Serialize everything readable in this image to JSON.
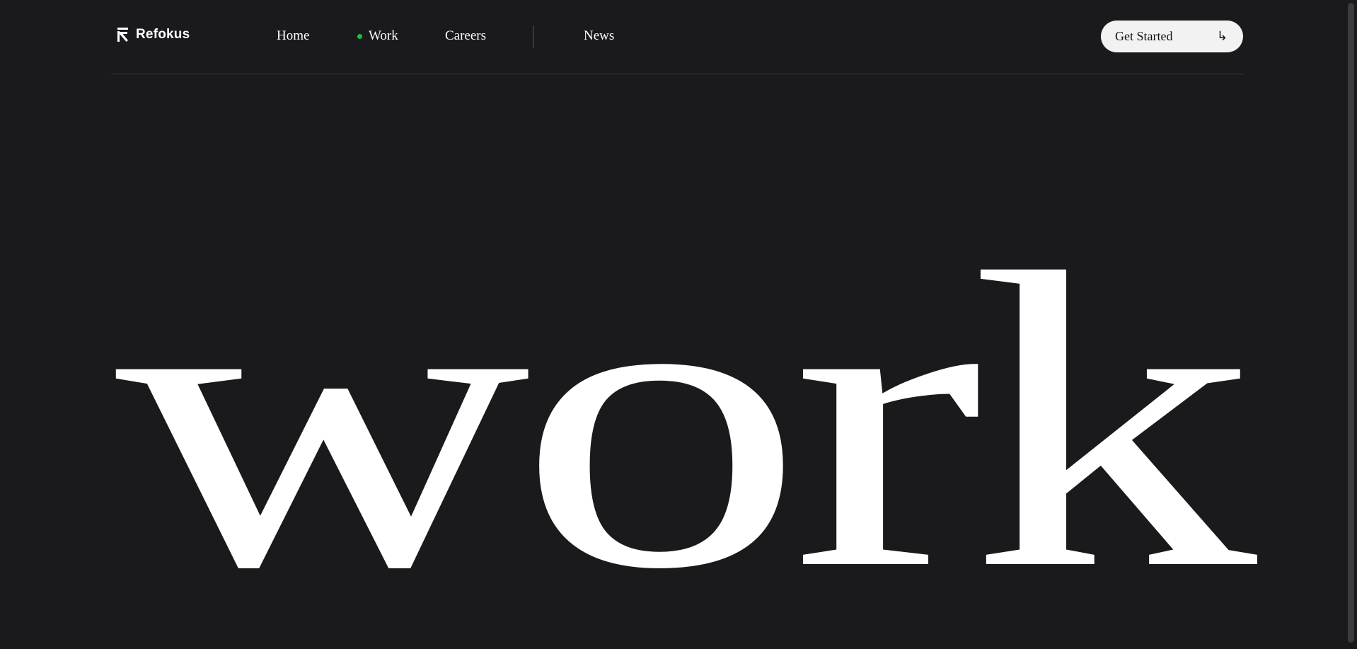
{
  "brand": {
    "name": "Refokus"
  },
  "nav": {
    "items": [
      {
        "label": "Home",
        "active": false
      },
      {
        "label": "Work",
        "active": true
      },
      {
        "label": "Careers",
        "active": false
      },
      {
        "label": "News",
        "active": false
      }
    ],
    "active_indicator_color": "#1fbf3a"
  },
  "cta": {
    "label": "Get Started",
    "icon": "arrow-down-right-icon"
  },
  "hero": {
    "heading": "work"
  },
  "colors": {
    "background": "#1a1a1c",
    "text": "#ffffff",
    "cta_background": "#f2f2f2"
  }
}
